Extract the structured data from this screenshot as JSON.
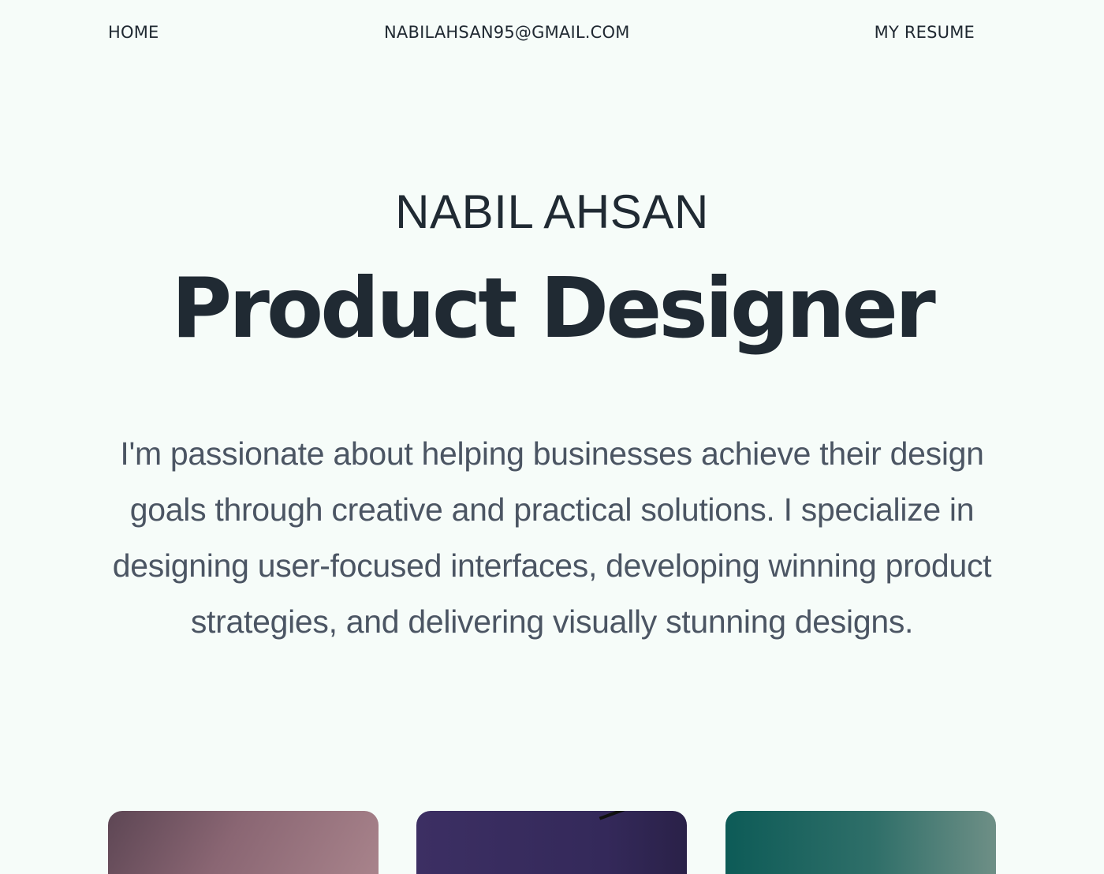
{
  "nav": {
    "home": "HOME",
    "email": "NABILAHSAN95@GMAIL.COM",
    "resume": "MY RESUME"
  },
  "hero": {
    "name": "NABIL AHSAN",
    "title": "Product Designer",
    "intro": "I'm passionate about helping businesses achieve their design goals through creative and practical solutions. I specialize in designing user-focused interfaces, developing winning product strategies, and delivering visually stunning designs."
  },
  "colors": {
    "background": "#f6fcf9",
    "heading": "#202a33",
    "body_text": "#4b5563"
  }
}
